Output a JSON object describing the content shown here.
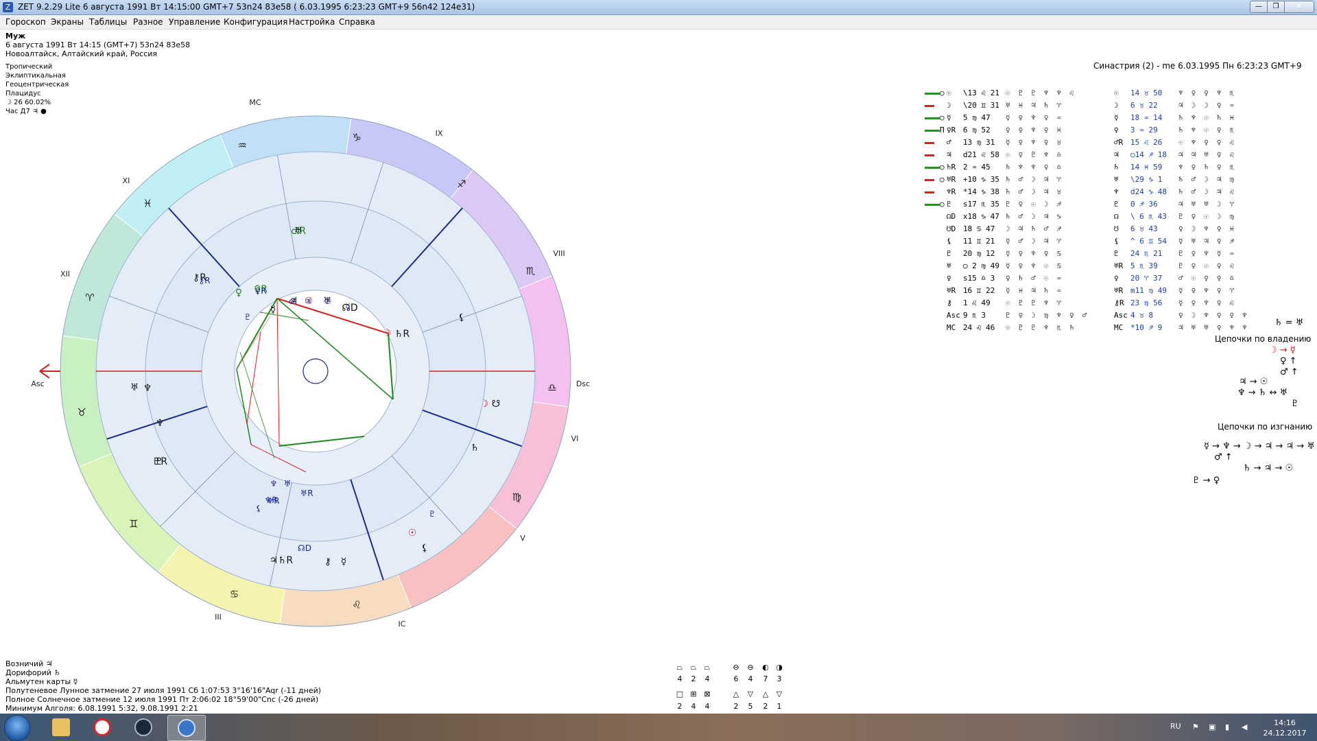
{
  "window": {
    "title": "ZET 9.2.29 Lite    6 августа 1991  Вт  14:15:00 GMT+7 53n24  83e58   ( 6.03.1995   6:23:23 GMT+9 56n42 124e31)",
    "app_icon_glyph": "Z"
  },
  "menu": [
    "Гороскоп",
    "Экраны",
    "Таблицы",
    "Разное",
    "Управление",
    "Конфигурация",
    "Настройка",
    "Справка"
  ],
  "person": {
    "name": "Муж",
    "date_line": "6 августа 1991  Вт  14:15 (GMT+7) 53n24  83e58",
    "place": "Новоалтайск, Алтайский край, Россия"
  },
  "settings": [
    "Тропический",
    "Эклиптикальная",
    "Геоцентрическая",
    "Плацидус"
  ],
  "moon_phase": "☽   26 60.02%",
  "hour_line": "Час Д7  ♃  ●",
  "synastry": "Синастрия (2) - me  6.03.1995  Пн  6:23:23 GMT+9",
  "chart": {
    "signs": [
      "♌",
      "♋",
      "♊",
      "♉",
      "♈",
      "♓",
      "♒",
      "♑",
      "♐",
      "♏",
      "♎",
      "♍"
    ],
    "houses": [
      "MC",
      "IX",
      "VIII",
      "Dsc",
      "VI",
      "V",
      "IC",
      "III",
      "Asc",
      "XII",
      "XI"
    ],
    "outer_planets": [
      "♂R",
      "♀R",
      "☿",
      "♃",
      "☉",
      "♅",
      "☊D",
      "☽",
      "♄R",
      "⚸",
      "☽",
      "☋",
      "♆",
      "♇",
      "♄",
      "☉",
      "⚸",
      "⚷R",
      "♀",
      "♅",
      "♆",
      "♇R",
      "☿",
      "♃",
      "♄R",
      "⚷",
      "♅"
    ],
    "inner_planets": [
      "⚷R",
      "♀R",
      "♇",
      "♂",
      "♃",
      "☉",
      "☿",
      "♆",
      "♅",
      "♆R",
      "⚸",
      "♅R",
      "♆R",
      "♇",
      "☊D"
    ]
  },
  "aspect_rows": [
    {
      "lead": "○",
      "pl": "☉",
      "pos": "\\13 ♌ 21",
      "glyphs": "☉♇♇♆♆♌",
      "pl2": "☉",
      "pos2": "14 ♉ 50",
      "glyphs2": "♆♀♀♆♏",
      "bar": "#1a9a1a"
    },
    {
      "lead": "",
      "pl": "☽",
      "pos": "\\20 ♊ 31",
      "glyphs": "♅♓♃♄♈",
      "pl2": "☽",
      "pos2": "6 ♉ 22",
      "glyphs2": "♃☽☽♀♒",
      "bar": "#d62020"
    },
    {
      "lead": "○",
      "pl": "☿",
      "pos": "5 ♍ 47",
      "glyphs": "☿♀♆♀♒",
      "pl2": "☿",
      "pos2": "18 ♒ 14",
      "glyphs2": "♄♆☉♄♓",
      "bar": "#1a9a1a"
    },
    {
      "lead": "Π",
      "pl": "♀R",
      "pos": "6 ♍ 52",
      "glyphs": "♀♀♆♀♓",
      "pl2": "♀",
      "pos2": "3 ♒ 29",
      "glyphs2": "♄♆☉♀♏",
      "bar": "#1a9a1a"
    },
    {
      "lead": "",
      "pl": "♂",
      "pos": "13 ♍ 31",
      "glyphs": "☿♀♆♀♉",
      "pl2": "♂R",
      "pos2": "15 ♌ 26",
      "glyphs2": "☉♆♀♀♌",
      "bar": "#d62020"
    },
    {
      "lead": "",
      "pl": "♃",
      "pos": "d21 ♌ 58",
      "glyphs": "☉♀♇♆♎",
      "pl2": "♃",
      "pos2": "○14 ♐ 18",
      "glyphs2": "♃♃♅♀♌",
      "bar": "#d62020"
    },
    {
      "lead": "○",
      "pl": "♄R",
      "pos": "2 ♒ 45",
      "glyphs": "♄♆♆♀♎",
      "pl2": "♄",
      "pos2": "14 ♓ 59",
      "glyphs2": "♆♀♄♀♏",
      "bar": "#1a9a1a"
    },
    {
      "lead": "○",
      "pl": "♅R",
      "pos": "+10 ♑ 35",
      "glyphs": "♄♂☽♃♈",
      "pl2": "♅",
      "pos2": "\\29 ♑ 1",
      "glyphs2": "♄♂☽♃♍",
      "bar": "#d62020"
    },
    {
      "lead": "",
      "pl": "♆R",
      "pos": "*14 ♑ 38",
      "glyphs": "♄♂☽♃♉",
      "pl2": "♆",
      "pos2": "d24 ♑ 48",
      "glyphs2": "♄♂☽♃♌",
      "bar": "#d62020"
    },
    {
      "lead": "○",
      "pl": "♇",
      "pos": "s17 ♏ 35",
      "glyphs": "♇♀☉☽♐",
      "pl2": "♇",
      "pos2": "0 ♐ 36",
      "glyphs2": "♃♅♅☽♈",
      "bar": "#1a9a1a"
    },
    {
      "lead": "",
      "pl": "☊D",
      "pos": "x18 ♑ 47",
      "glyphs": "♄♂☽♃♑",
      "pl2": "☊",
      "pos2": "\\ 6 ♏ 43",
      "glyphs2": "♇♀☉☽♍",
      "bar": ""
    },
    {
      "lead": "",
      "pl": "☋D",
      "pos": "18 ♋ 47",
      "glyphs": "☽♃♄♂♐",
      "pl2": "☋",
      "pos2": "6 ♉ 43",
      "glyphs2": "♀☽♆♀♓",
      "bar": ""
    },
    {
      "lead": "",
      "pl": "⚸",
      "pos": "11 ♊ 21",
      "glyphs": "☿♂☽♃♈",
      "pl2": "⚸",
      "pos2": "^ 6 ♊ 54",
      "glyphs2": "☿♅♃♀♐",
      "bar": ""
    },
    {
      "lead": "",
      "pl": "♇",
      "pos": "20 ♍ 12",
      "glyphs": "☿♀♆♀♋",
      "pl2": "♇",
      "pos2": "24 ♏ 21",
      "glyphs2": "♇♀♆☿♒",
      "bar": ""
    },
    {
      "lead": "",
      "pl": "♅",
      "pos": "○ 2 ♍ 49",
      "glyphs": "☿♀♆☉♋",
      "pl2": "♅R",
      "pos2": "5 ♏ 39",
      "glyphs2": "♇♀☉♀♌",
      "bar": ""
    },
    {
      "lead": "",
      "pl": "♀",
      "pos": "s15 ♎ 3",
      "glyphs": "♀♄♂☉♒",
      "pl2": "♀",
      "pos2": "20 ♈ 37",
      "glyphs2": "♂☉♀♀♎",
      "bar": ""
    },
    {
      "lead": "",
      "pl": "♅R",
      "pos": "16 ♊ 22",
      "glyphs": "☿♓♃♄♒",
      "pl2": "♅R",
      "pos2": "m11 ♍ 49",
      "glyphs2": "☿♀♆♀♈",
      "bar": ""
    },
    {
      "lead": "",
      "pl": "⚷",
      "pos": "1 ♌ 49",
      "glyphs": "☉♇♇♆♈",
      "pl2": "⚷R",
      "pos2": "23 ♍ 56",
      "glyphs2": "☿♀♆♀♌",
      "bar": ""
    },
    {
      "lead": "",
      "pl": "Asc",
      "pos": "9 ♏ 3",
      "glyphs": "♇♀☽♍♆♀♂",
      "pl2": "Asc",
      "pos2": "4 ♉ 8",
      "glyphs2": "♀☽♆♀♀♆",
      "bar": ""
    },
    {
      "lead": "",
      "pl": "MC",
      "pos": "24 ♌ 46",
      "glyphs": "☉♇♇♆♏♄",
      "pl2": "MC",
      "pos2": "*10 ♐ 9",
      "glyphs2": "♃♅♅♀♆♆",
      "bar": ""
    }
  ],
  "rulership": {
    "eq": "♄ = ♅",
    "title": "Цепочки по владению",
    "lines": [
      "☽ → ☿",
      "♀ ↑",
      "♂ ↑",
      "♃ → ☉",
      "♆ → ♄ ↔ ♅",
      "♇"
    ]
  },
  "exile": {
    "title": "Цепочки по изгнанию",
    "lines": [
      "☿ → ♆ → ☽ → ♃ → ♃ → ♅",
      "♂ ↑",
      "♄ → ♃ → ☉",
      "♇ → ♀"
    ]
  },
  "bottom": {
    "lines": [
      "Возничий  ♃",
      "Дорифорий  ♄",
      "Альмутен карты  ☿",
      "Полутеневое Лунное затмение 27 июля 1991 Сб  1:07:53  3°16'16\"Aqr (-11 дней)",
      "Полное Солнечное затмение 12 июля 1991 Пт  2:06:02 18°59'00\"Cnc (-26 дней)",
      "Минимум Алголя: 6.08.1991  5:32,  9.08.1991  2:21"
    ]
  },
  "element_grid": {
    "top_syms": [
      "⏢",
      "⏢",
      "⏢",
      "⊖",
      "⊖",
      "◐",
      "◑"
    ],
    "top_vals": [
      "4",
      "2",
      "4",
      "6",
      "4",
      "7",
      "3"
    ],
    "bot_syms": [
      "□",
      "⊞",
      "⊠",
      "△",
      "▽",
      "△",
      "▽"
    ],
    "bot_vals": [
      "2",
      "4",
      "4",
      "2",
      "5",
      "2",
      "1"
    ]
  },
  "taskbar": {
    "lang": "RU",
    "time": "14:16",
    "date": "24.12.2017"
  }
}
